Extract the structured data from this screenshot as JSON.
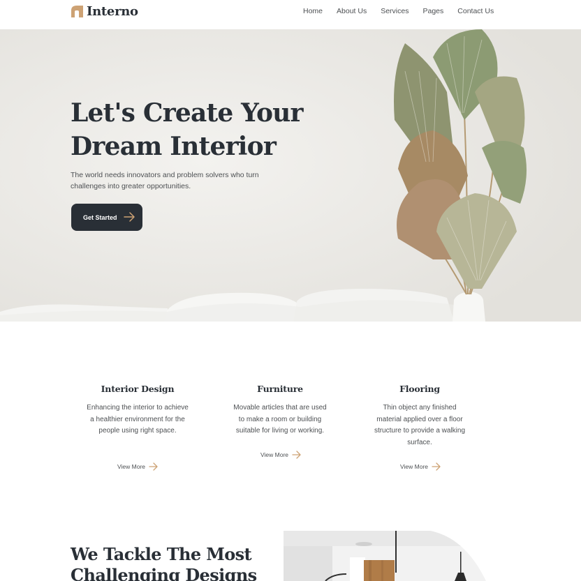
{
  "header": {
    "logo_text": "Interno",
    "nav": [
      "Home",
      "About Us",
      "Services",
      "Pages",
      "Contact Us"
    ]
  },
  "hero": {
    "title_line1": "Let's Create Your",
    "title_line2": "Dream Interior",
    "subtitle_line1": "The world needs innovators and problem solvers who turn",
    "subtitle_line2": "challenges into greater opportunities.",
    "cta_label": "Get Started"
  },
  "services": [
    {
      "title": "Interior Design",
      "lines": [
        "Enhancing the interior to achieve",
        "a healthier environment for the",
        "people using right space."
      ],
      "link": "View More"
    },
    {
      "title": "Furniture",
      "lines": [
        "Movable articles that are used",
        "to make a room or building",
        "suitable for living or working."
      ],
      "link": "View More"
    },
    {
      "title": "Flooring",
      "lines": [
        "Thin object any finished",
        "material applied over a floor",
        "structure to provide a walking",
        "surface."
      ],
      "link": "View More"
    }
  ],
  "section2": {
    "title_line1": "We Tackle The Most",
    "title_line2": "Challenging Designs"
  },
  "colors": {
    "primary": "#292f36",
    "accent": "#cda274",
    "text": "#4d5053"
  }
}
